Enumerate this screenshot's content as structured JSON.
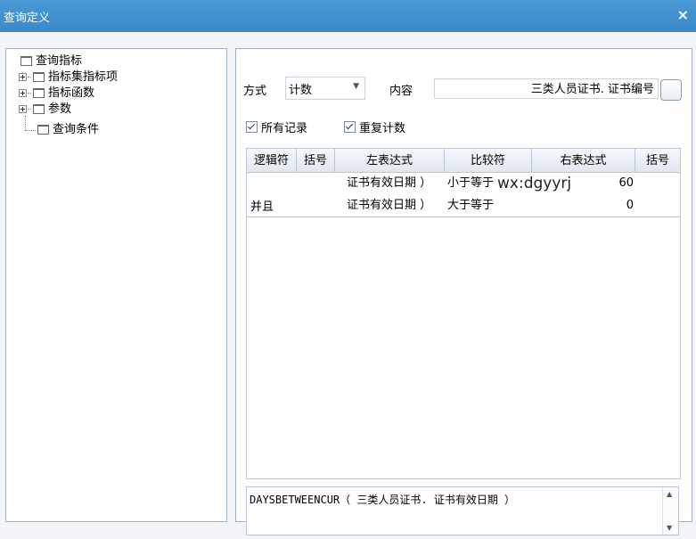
{
  "window": {
    "title": "查询定义",
    "close_glyph": "×"
  },
  "tree": {
    "items": [
      {
        "label": "查询指标",
        "expander": false
      },
      {
        "label": "指标集指标项",
        "expander": true
      },
      {
        "label": "指标函数",
        "expander": true
      },
      {
        "label": "参数",
        "expander": true
      },
      {
        "label": "查询条件",
        "expander": false
      }
    ]
  },
  "query": {
    "method_label": "方式",
    "method_value": "计数",
    "content_label": "内容",
    "content_value": "三类人员证书. 证书编号",
    "all_records_label": "所有记录",
    "all_records_checked": true,
    "repeat_count_label": "重复计数",
    "repeat_count_checked": true
  },
  "grid": {
    "columns": [
      "逻辑符",
      "括号",
      "左表达式",
      "比较符",
      "右表达式",
      "括号"
    ],
    "rows": [
      {
        "logic": "",
        "open_paren": "",
        "left": "证书有效日期 ）",
        "op": "小于等于",
        "right": "60",
        "close_paren": ""
      },
      {
        "logic": "并且",
        "open_paren": "",
        "left": "证书有效日期 ）",
        "op": "大于等于",
        "right": "0",
        "close_paren": ""
      }
    ]
  },
  "formula": {
    "text": "DAYSBETWEENCUR（ 三类人员证书. 证书有效日期 ）"
  },
  "watermark": "wx:dgyyrj"
}
